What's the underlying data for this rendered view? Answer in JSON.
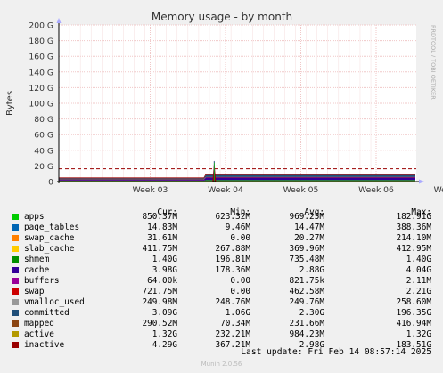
{
  "chart_data": {
    "type": "area",
    "title": "Memory usage - by month",
    "ylabel": "Bytes",
    "side_label": "RRDTOOL / TOBI OETIKER",
    "ylim": [
      0,
      200
    ],
    "y_unit": "G",
    "yticks": [
      "0",
      "20 G",
      "40 G",
      "60 G",
      "80 G",
      "100 G",
      "120 G",
      "140 G",
      "160 G",
      "180 G",
      "200 G"
    ],
    "xticks": [
      "Week 03",
      "Week 04",
      "Week 05",
      "Week 06",
      "Week 07"
    ],
    "grid": true,
    "dashed_line_value": 16.4,
    "spike": {
      "week_position": 3.85,
      "peak_value": 27
    },
    "series": [
      {
        "name": "apps",
        "color": "#00cc00",
        "cur": "850.37M",
        "min": "623.32M",
        "avg": "969.25M",
        "max": "182.91G"
      },
      {
        "name": "page_tables",
        "color": "#0066b3",
        "cur": "14.83M",
        "min": "9.46M",
        "avg": "14.47M",
        "max": "388.36M"
      },
      {
        "name": "swap_cache",
        "color": "#ff8000",
        "cur": "31.61M",
        "min": "0.00",
        "avg": "20.27M",
        "max": "214.10M"
      },
      {
        "name": "slab_cache",
        "color": "#ffcc00",
        "cur": "411.75M",
        "min": "267.88M",
        "avg": "369.96M",
        "max": "412.95M"
      },
      {
        "name": "shmem",
        "color": "#008f00",
        "cur": "1.40G",
        "min": "196.81M",
        "avg": "735.48M",
        "max": "1.40G"
      },
      {
        "name": "cache",
        "color": "#330099",
        "cur": "3.98G",
        "min": "178.36M",
        "avg": "2.88G",
        "max": "4.04G"
      },
      {
        "name": "buffers",
        "color": "#990099",
        "cur": "64.00k",
        "min": "0.00",
        "avg": "821.75k",
        "max": "2.11M"
      },
      {
        "name": "swap",
        "color": "#cc0000",
        "cur": "721.75M",
        "min": "0.00",
        "avg": "462.58M",
        "max": "2.21G"
      },
      {
        "name": "vmalloc_used",
        "color": "#999999",
        "cur": "249.98M",
        "min": "248.76M",
        "avg": "249.76M",
        "max": "258.60M"
      },
      {
        "name": "committed",
        "color": "#1f4e79",
        "cur": "3.09G",
        "min": "1.06G",
        "avg": "2.30G",
        "max": "196.35G"
      },
      {
        "name": "mapped",
        "color": "#8b4513",
        "cur": "290.52M",
        "min": "70.34M",
        "avg": "231.66M",
        "max": "416.94M"
      },
      {
        "name": "active",
        "color": "#b39900",
        "cur": "1.32G",
        "min": "232.21M",
        "avg": "984.23M",
        "max": "1.32G"
      },
      {
        "name": "inactive",
        "color": "#990000",
        "cur": "4.29G",
        "min": "367.21M",
        "avg": "2.98G",
        "max": "183.51G"
      }
    ]
  },
  "legend_headers": {
    "cur": "Cur:",
    "min": "Min:",
    "avg": "Avg:",
    "max": "Max:"
  },
  "last_update": "Last update: Fri Feb 14 08:57:14 2025",
  "footer": "Munin 2.0.56"
}
